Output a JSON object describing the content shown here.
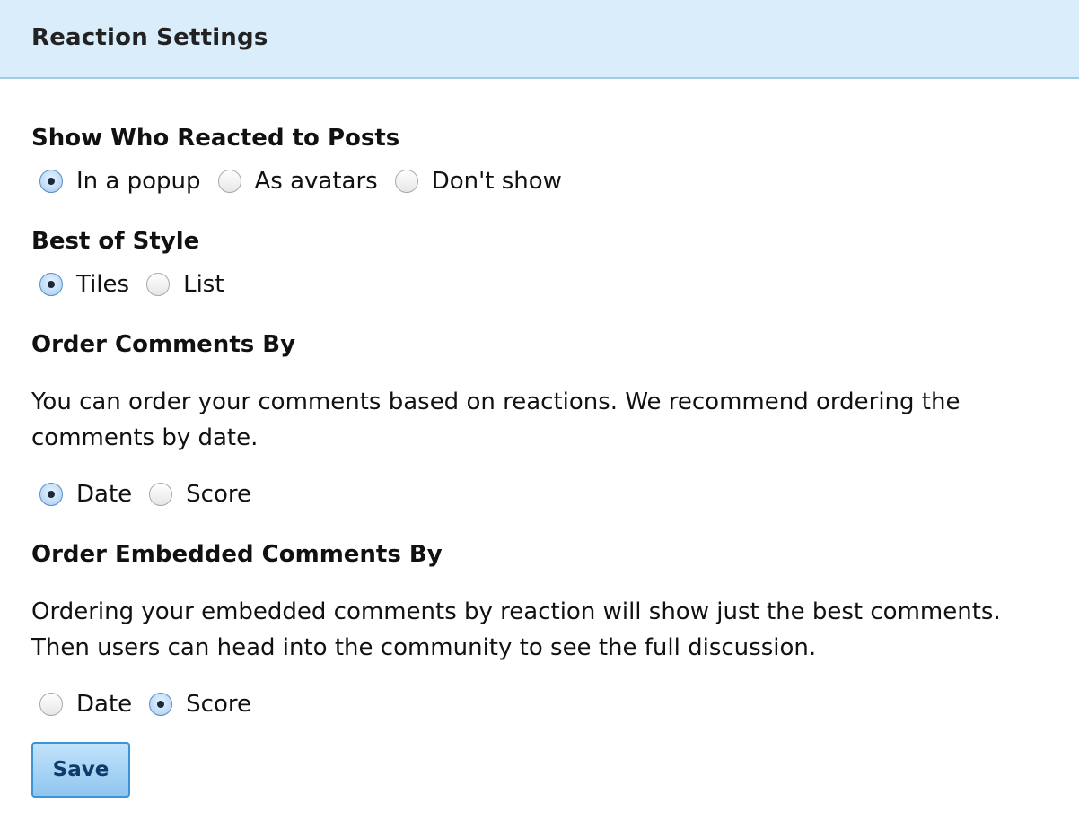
{
  "header": {
    "title": "Reaction Settings"
  },
  "sections": {
    "show_who_reacted": {
      "title": "Show Who Reacted to Posts",
      "options": [
        "In a popup",
        "As avatars",
        "Don't show"
      ],
      "selected": "In a popup"
    },
    "best_of_style": {
      "title": "Best of Style",
      "options": [
        "Tiles",
        "List"
      ],
      "selected": "Tiles"
    },
    "order_comments": {
      "title": "Order Comments By",
      "description": "You can order your comments based on reactions. We recommend ordering the comments by date.",
      "options": [
        "Date",
        "Score"
      ],
      "selected": "Date"
    },
    "order_embedded_comments": {
      "title": "Order Embedded Comments By",
      "description": "Ordering your embedded comments by reaction will show just the best comments. Then users can head into the community to see the full discussion.",
      "options": [
        "Date",
        "Score"
      ],
      "selected": "Score"
    }
  },
  "save_label": "Save",
  "colors": {
    "header_bg": "#d9eefa",
    "header_border": "#9fcde6",
    "button_border": "#3d93d8",
    "button_text": "#0d3c6b"
  }
}
